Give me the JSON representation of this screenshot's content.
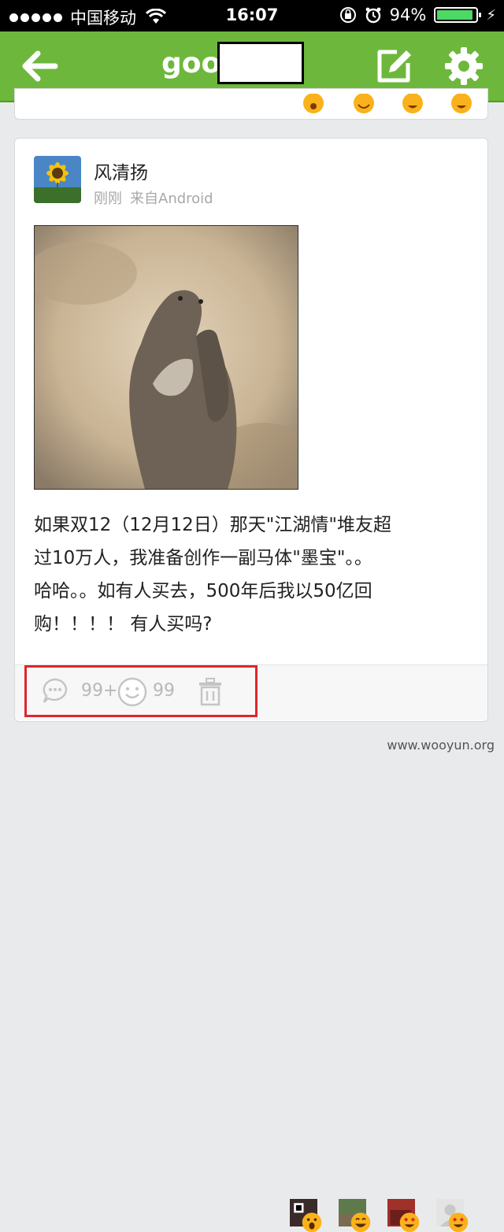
{
  "status_bar": {
    "carrier": "中国移动",
    "time": "16:07",
    "battery": "94%",
    "battery_level": 0.94
  },
  "nav": {
    "title": "goo"
  },
  "post": {
    "author": "风清扬",
    "time": "刚刚",
    "source": "来自Android",
    "lines": [
      "如果双12（12月12日）那天\"江湖情\"堆友超",
      "过10万人，我准备创作一副马体\"墨宝\"。。",
      "哈哈。。如有人买去，500年后我以50亿回",
      "购！！！！ 有人买吗?"
    ],
    "comment_count": "99+",
    "like_count": "99"
  },
  "watermark": "www.wooyun.org",
  "colors": {
    "nav_green": "#6db83c",
    "highlight_red": "#e0252c"
  }
}
